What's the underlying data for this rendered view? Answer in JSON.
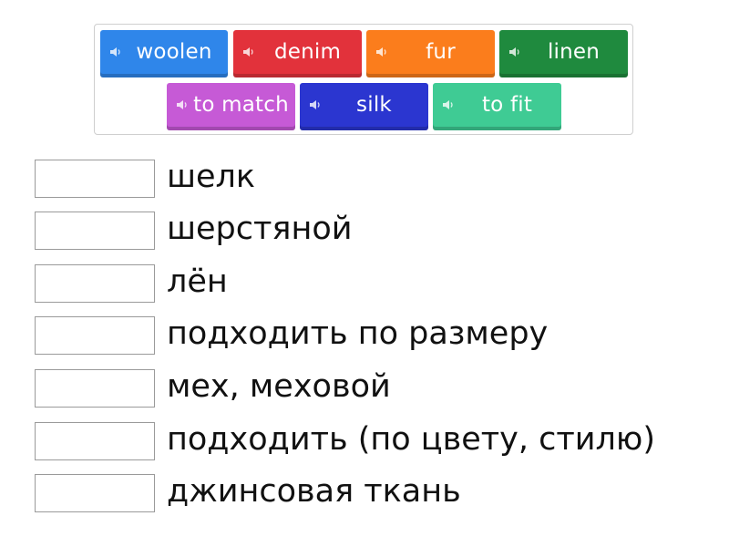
{
  "tiles": [
    {
      "label": "woolen",
      "color": "#2f86ea"
    },
    {
      "label": "denim",
      "color": "#e2323b"
    },
    {
      "label": "fur",
      "color": "#fb7d1c"
    },
    {
      "label": "linen",
      "color": "#1f8a3e"
    },
    {
      "label": "to match",
      "color": "#c65ad6"
    },
    {
      "label": "silk",
      "color": "#2b36d0"
    },
    {
      "label": "to fit",
      "color": "#3fcb94"
    }
  ],
  "targets": [
    {
      "text": "шелк"
    },
    {
      "text": "шерстяной"
    },
    {
      "text": "лён"
    },
    {
      "text": "подходить по размеру"
    },
    {
      "text": "мех, меховой"
    },
    {
      "text": "подходить (по цвету, стилю)"
    },
    {
      "text": "джинсовая ткань"
    }
  ]
}
